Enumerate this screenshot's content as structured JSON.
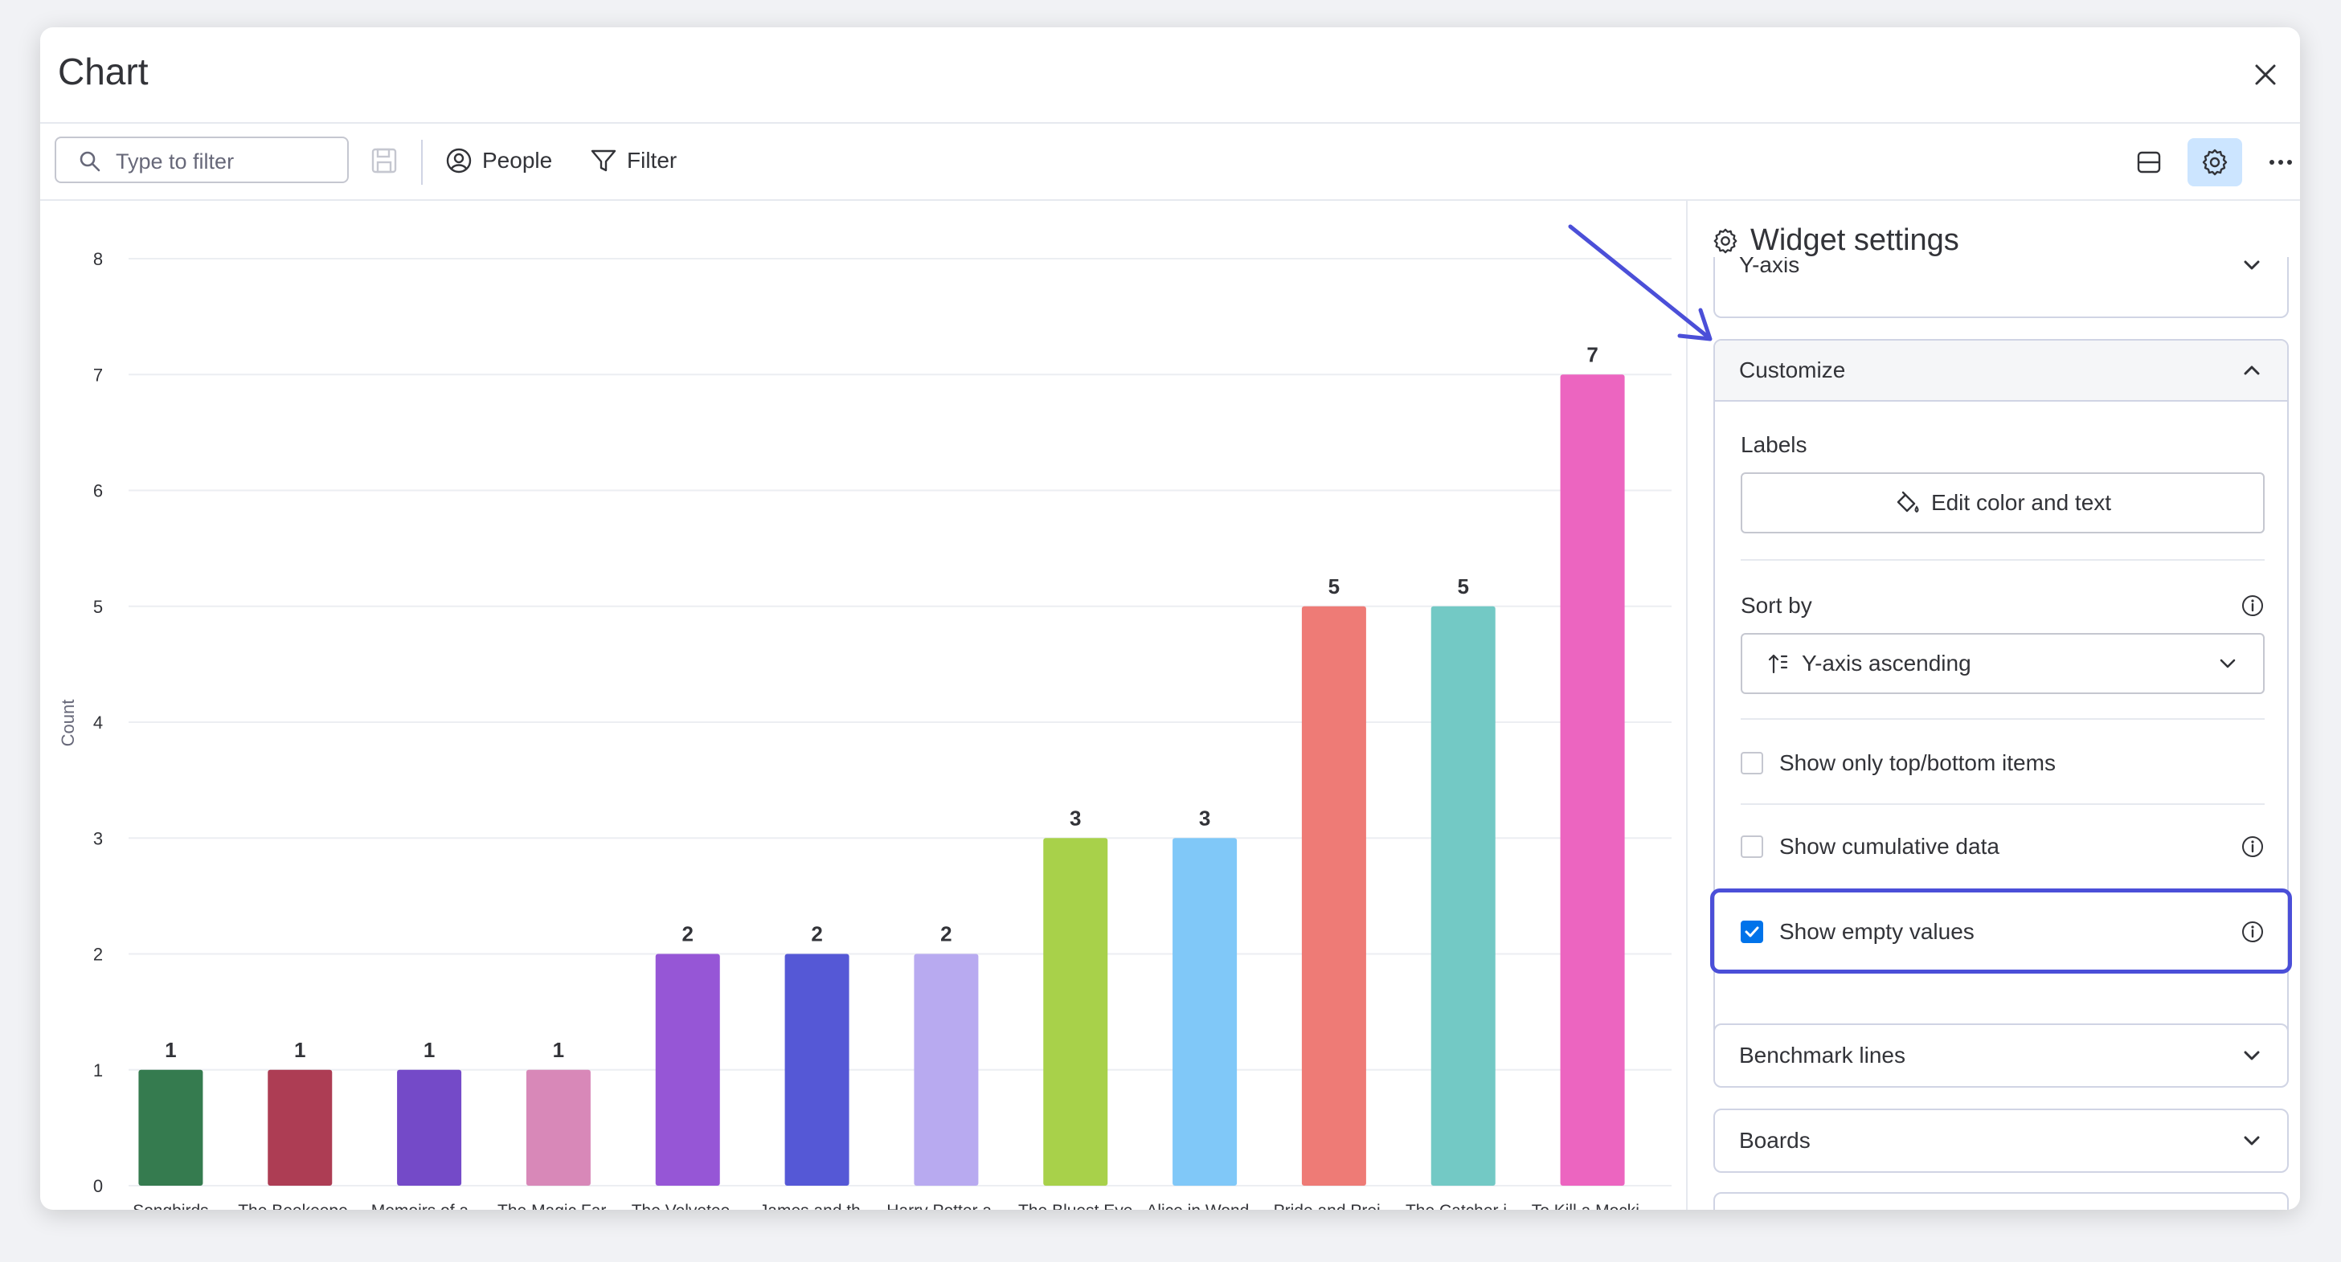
{
  "window": {
    "title": "Chart"
  },
  "toolbar": {
    "search_placeholder": "Type to filter",
    "people_label": "People",
    "filter_label": "Filter"
  },
  "panel": {
    "title": "Widget settings",
    "yaxis_label": "Y-axis",
    "customize_label": "Customize",
    "labels_label": "Labels",
    "edit_color_label": "Edit color and text",
    "sort_by_label": "Sort by",
    "sort_value": "Y-axis ascending",
    "opt_top_bottom": "Show only top/bottom items",
    "opt_cumulative": "Show cumulative data",
    "opt_empty": "Show empty values",
    "opt_empty_checked": true,
    "benchmark_label": "Benchmark lines",
    "boards_label": "Boards"
  },
  "chart_data": {
    "type": "bar",
    "ylabel": "Count",
    "xlabel": "",
    "ylim": [
      0,
      8
    ],
    "yticks": [
      0,
      1,
      2,
      3,
      4,
      5,
      6,
      7,
      8
    ],
    "grid": true,
    "categories": [
      "Songbirds",
      "The Beekeepe...",
      "Memoirs of a ...",
      "The Magic Far...",
      "The Velvetee...",
      "James and th...",
      "Harry Potter a...",
      "The Bluest Eye",
      "Alice in Wond...",
      "Pride and Prej...",
      "The Catcher i...",
      "To Kill a Mocki..."
    ],
    "values": [
      1,
      1,
      1,
      1,
      2,
      2,
      2,
      3,
      3,
      5,
      5,
      7
    ],
    "colors": [
      "#357b4f",
      "#ad3d54",
      "#744ac8",
      "#d888b8",
      "#9656d6",
      "#5558d6",
      "#b8aaf0",
      "#a8d14a",
      "#80c8f8",
      "#ee7b76",
      "#73c9c5",
      "#ec65c0"
    ]
  },
  "colors": {
    "accent": "#0073ea",
    "highlight": "#4b4fd8"
  }
}
